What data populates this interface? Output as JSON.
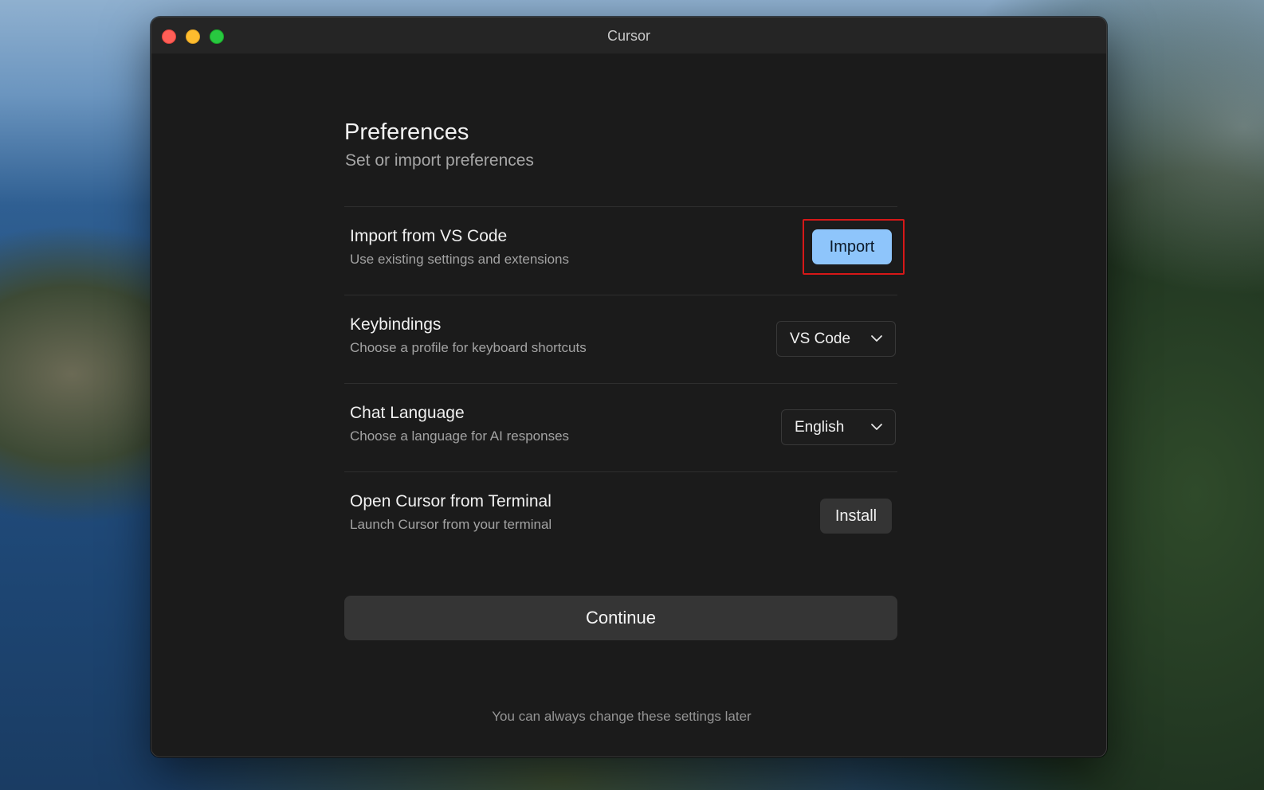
{
  "window": {
    "title": "Cursor"
  },
  "page": {
    "title": "Preferences",
    "subtitle": "Set or import preferences"
  },
  "rows": [
    {
      "title": "Import from VS Code",
      "description": "Use existing settings and extensions",
      "action_label": "Import"
    },
    {
      "title": "Keybindings",
      "description": "Choose a profile for keyboard shortcuts",
      "selected": "VS Code"
    },
    {
      "title": "Chat Language",
      "description": "Choose a language for AI responses",
      "selected": "English"
    },
    {
      "title": "Open Cursor from Terminal",
      "description": "Launch Cursor from your terminal",
      "action_label": "Install"
    }
  ],
  "continue_label": "Continue",
  "footnote": "You can always change these settings later",
  "colors": {
    "accent_button": "#8ec5fb",
    "highlight_box": "#d61818",
    "window_bg": "#1b1b1b"
  },
  "icons": [
    "close-traffic-light",
    "minimize-traffic-light",
    "maximize-traffic-light",
    "chevron-down-icon"
  ]
}
